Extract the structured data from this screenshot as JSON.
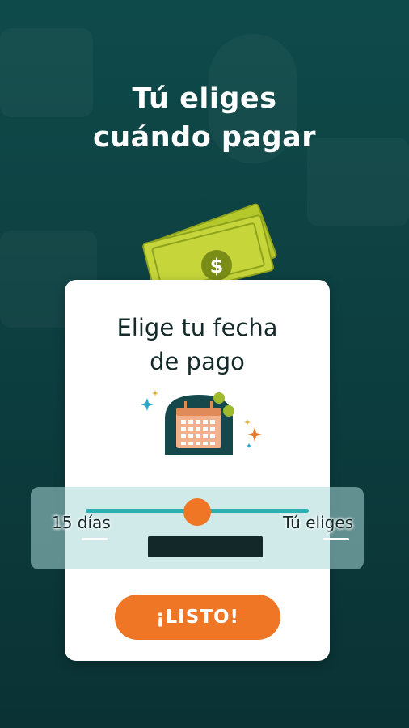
{
  "headline": {
    "line1": "Tú eliges",
    "line2": "cuándo pagar"
  },
  "card": {
    "title_line1": "Elige tu fecha",
    "title_line2": "de pago"
  },
  "slider": {
    "min_label": "15 días",
    "max_label": "Tú eliges",
    "value_fraction": 0.5
  },
  "cta": {
    "label": "¡LISTO!"
  },
  "colors": {
    "background": "#0f4a4a",
    "accent": "#ee7625",
    "track": "#2ab0b3",
    "money": "#c5d53a",
    "calendar_base": "#15484a",
    "calendar_accent": "#f2b08c"
  },
  "icons": {
    "money": "money-bills-icon",
    "calendar": "calendar-icon",
    "sparkles": "sparkle-icon",
    "coin": "coin-icon"
  }
}
